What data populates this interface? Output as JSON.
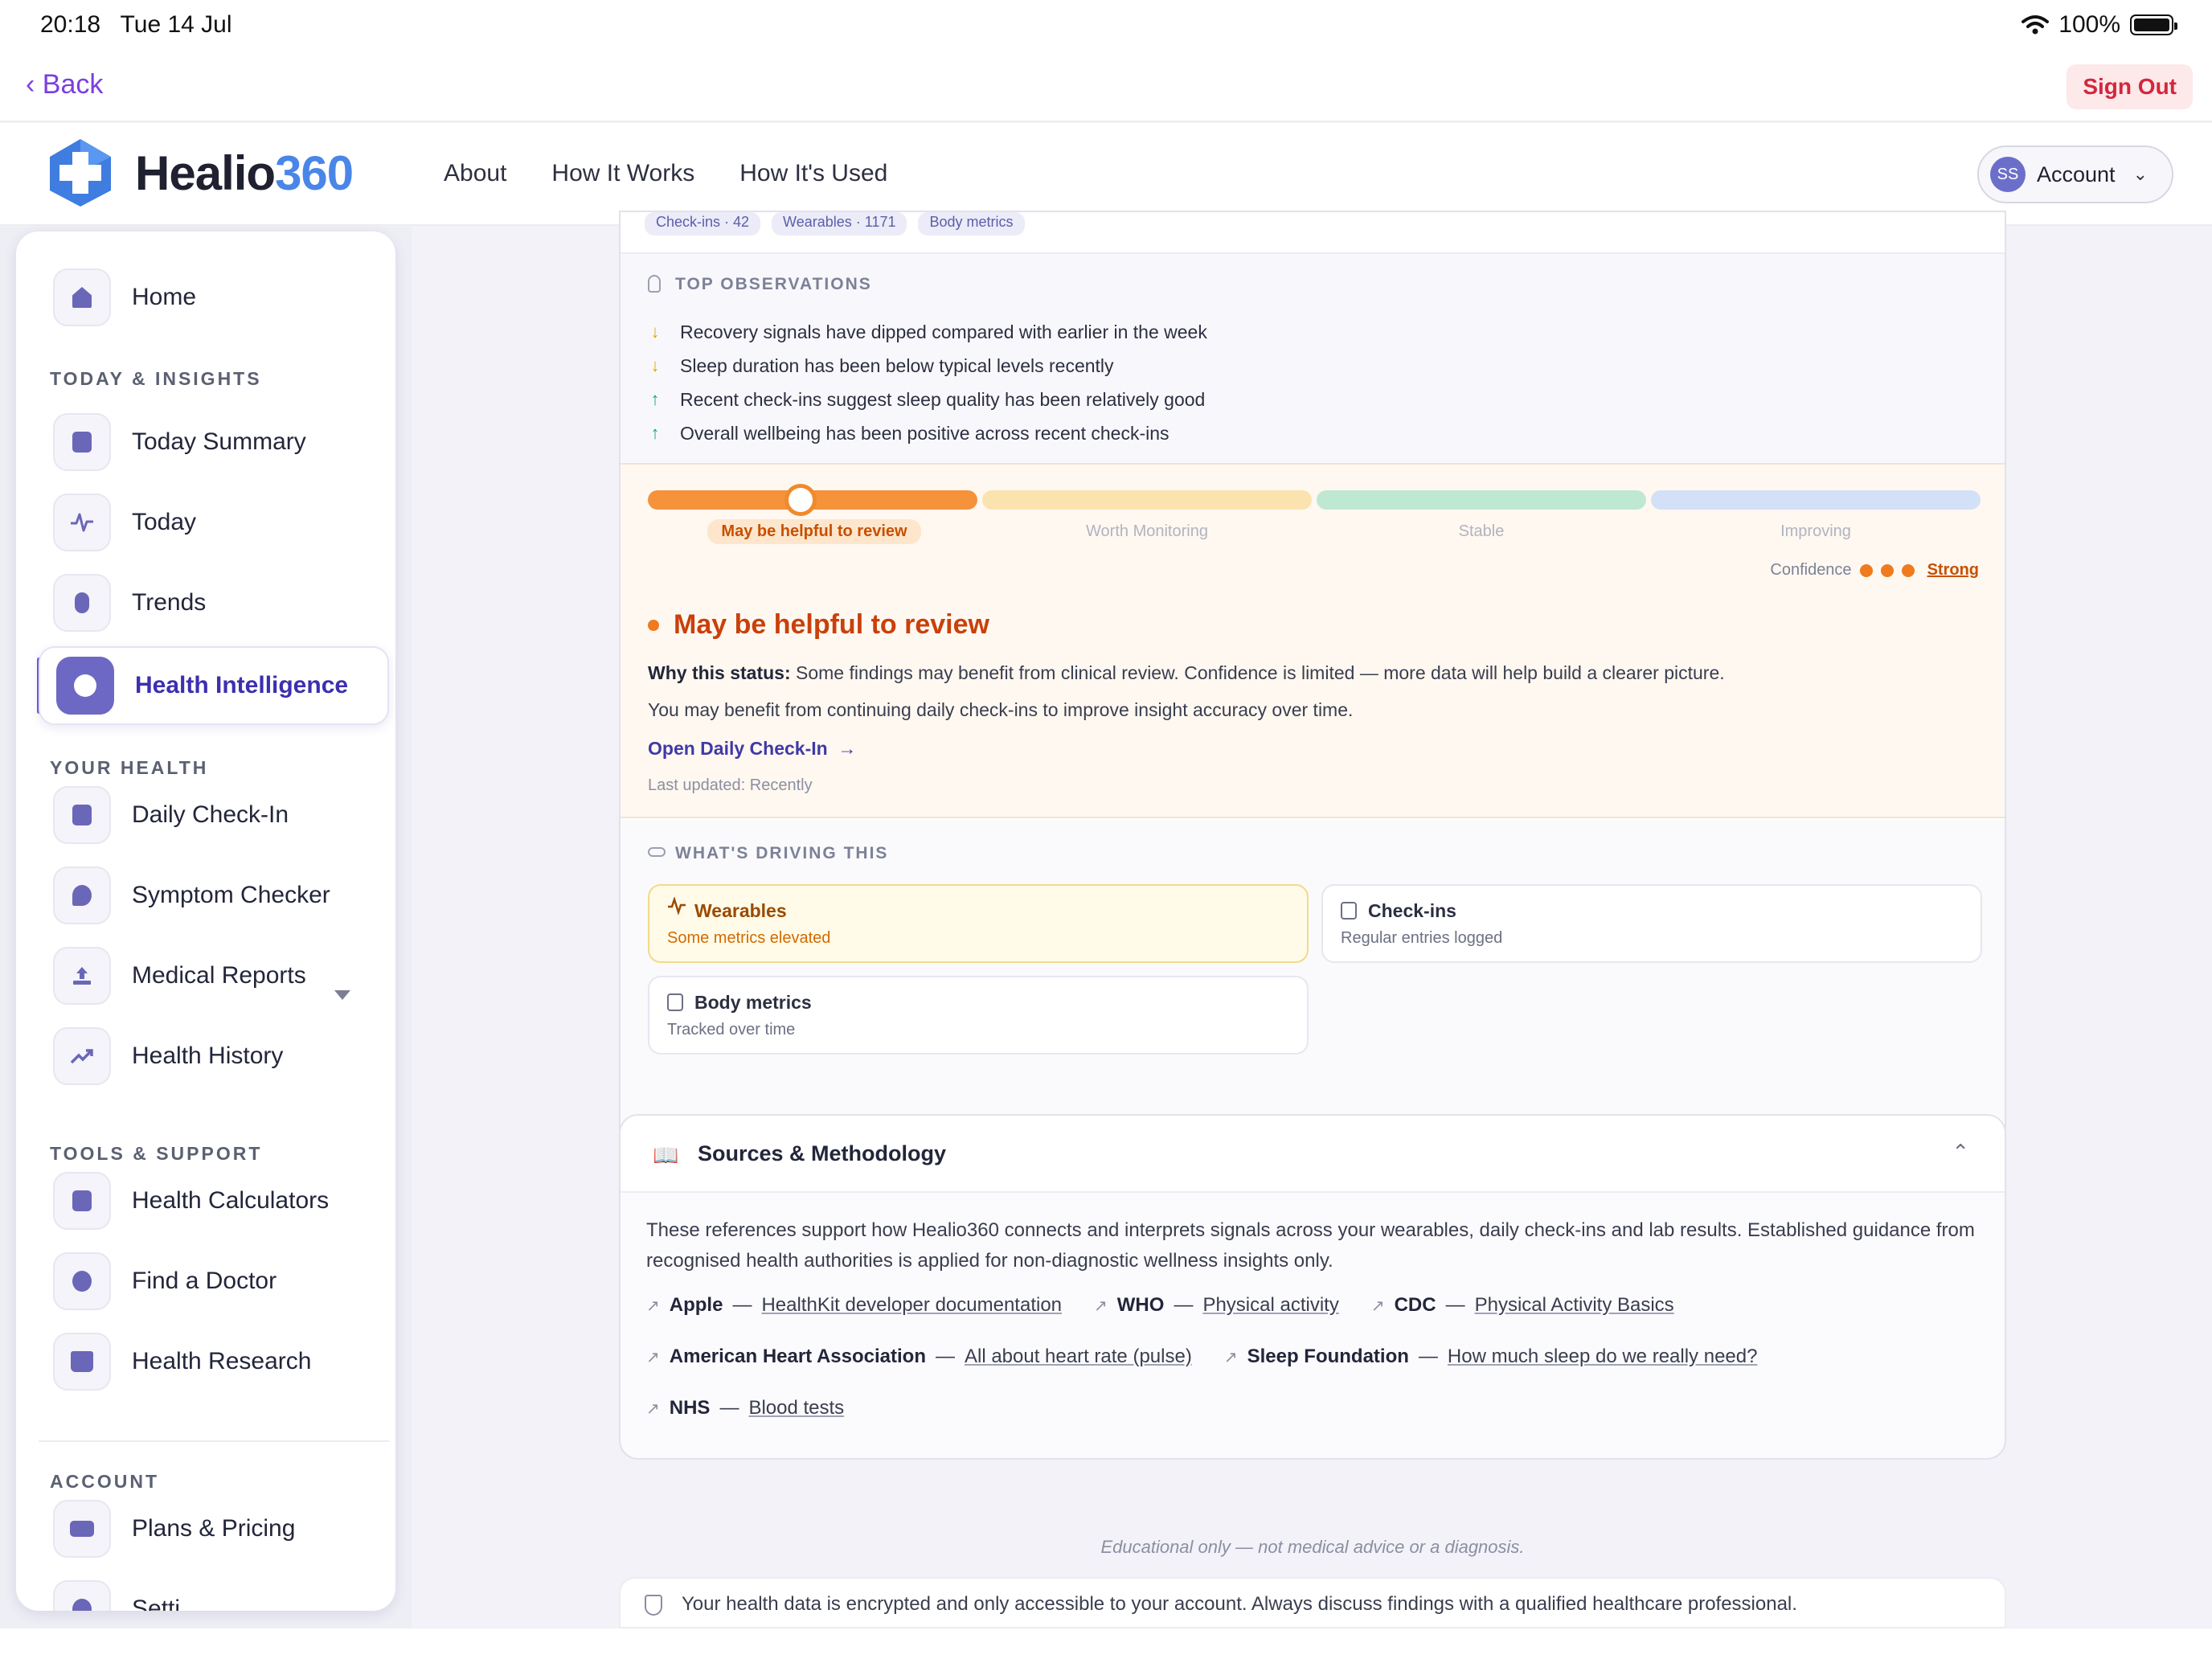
{
  "status_bar": {
    "time": "20:18",
    "date": "Tue 14 Jul",
    "battery": "100%",
    "battery_level": 1.0
  },
  "top_bar": {
    "back": "Back",
    "sign_out": "Sign Out"
  },
  "header": {
    "brand_part1": "Healio",
    "brand_part2": "360",
    "nav": [
      "About",
      "How It Works",
      "How It's Used"
    ],
    "account": {
      "initials": "SS",
      "label": "Account"
    }
  },
  "sidebar": {
    "home": "Home",
    "sections": {
      "today": "TODAY & INSIGHTS",
      "health": "YOUR HEALTH",
      "tools": "TOOLS & SUPPORT",
      "account": "ACCOUNT"
    },
    "items": {
      "today_summary": "Today Summary",
      "today": "Today",
      "trends": "Trends",
      "health_intelligence": "Health Intelligence",
      "daily_checkin": "Daily Check-In",
      "symptom_checker": "Symptom Checker",
      "medical_reports": "Medical Reports",
      "health_history": "Health History",
      "health_calculators": "Health Calculators",
      "find_doctor": "Find a Doctor",
      "health_research": "Health Research",
      "plans_pricing": "Plans & Pricing",
      "settings_partial": "Setti"
    }
  },
  "insight_card": {
    "chips": [
      "Check-ins · 42",
      "Wearables · 1171",
      "Body metrics"
    ],
    "observations_title": "TOP OBSERVATIONS",
    "observations": [
      {
        "dir": "down",
        "text": "Recovery signals have dipped compared with earlier in the week"
      },
      {
        "dir": "down",
        "text": "Sleep duration has been below typical levels recently"
      },
      {
        "dir": "up",
        "text": "Recent check-ins suggest sleep quality has been relatively good"
      },
      {
        "dir": "up",
        "text": "Overall wellbeing has been positive across recent check-ins"
      }
    ],
    "scale": {
      "segments": [
        "May be helpful to review",
        "Worth Monitoring",
        "Stable",
        "Improving"
      ],
      "colors": [
        "#f5923a",
        "#fbe3b0",
        "#bfe8d2",
        "#d3e1f8"
      ],
      "current_index": 0
    },
    "confidence": {
      "label": "Confidence",
      "level": "Strong",
      "dots": 3
    },
    "status": {
      "title": "May be helpful to review",
      "why_label": "Why this status:",
      "why_text": " Some findings may benefit from clinical review. Confidence is limited — more data will help build a clearer picture.",
      "more": "You may benefit from continuing daily check-ins to improve insight accuracy over time.",
      "link": "Open Daily Check-In",
      "updated": "Last updated: Recently"
    },
    "driving": {
      "title": "WHAT'S DRIVING THIS",
      "cards": [
        {
          "title": "Wearables",
          "sub": "Some metrics elevated"
        },
        {
          "title": "Check-ins",
          "sub": "Regular entries logged"
        },
        {
          "title": "Body metrics",
          "sub": "Tracked over time"
        }
      ]
    }
  },
  "sources": {
    "title": "Sources & Methodology",
    "description": "These references support how Healio360 connects and interprets signals across your wearables, daily check-ins and lab results. Established guidance from recognised health authorities is applied for non-diagnostic wellness insights only.",
    "refs": [
      {
        "org": "Apple",
        "link": "HealthKit developer documentation"
      },
      {
        "org": "WHO",
        "link": "Physical activity"
      },
      {
        "org": "CDC",
        "link": "Physical Activity Basics"
      },
      {
        "org": "American Heart Association",
        "link": "All about heart rate (pulse)"
      },
      {
        "org": "Sleep Foundation",
        "link": "How much sleep do we really need?"
      },
      {
        "org": "NHS",
        "link": "Blood tests"
      }
    ]
  },
  "footer": {
    "disclaimer": "Educational only — not medical advice or a diagnosis.",
    "security": "Your health data is encrypted and only accessible to your account. Always discuss findings with a qualified healthcare professional."
  }
}
